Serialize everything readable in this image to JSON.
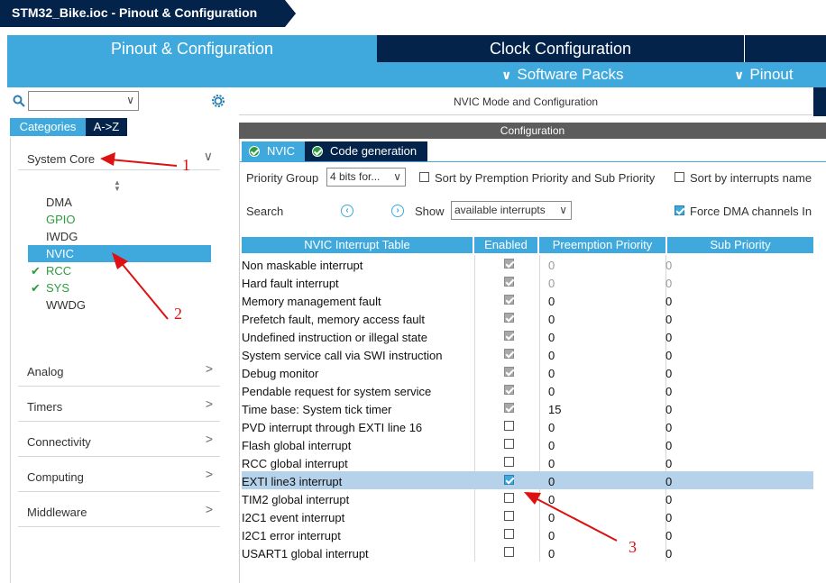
{
  "window": {
    "title": "STM32_Bike.ioc - Pinout & Configuration"
  },
  "tabs": {
    "pinout": "Pinout & Configuration",
    "clock": "Clock Configuration",
    "software_packs": "Software Packs",
    "pinout_menu": "Pinout"
  },
  "sidebar": {
    "search_value": "",
    "tab_categories": "Categories",
    "tab_az": "A->Z",
    "categories": [
      "System Core",
      "Analog",
      "Timers",
      "Connectivity",
      "Computing",
      "Middleware"
    ],
    "system_core_items": [
      {
        "label": "DMA",
        "state": "normal"
      },
      {
        "label": "GPIO",
        "state": "green"
      },
      {
        "label": "IWDG",
        "state": "normal"
      },
      {
        "label": "NVIC",
        "state": "selected"
      },
      {
        "label": "RCC",
        "state": "checked"
      },
      {
        "label": "SYS",
        "state": "checked"
      },
      {
        "label": "WWDG",
        "state": "normal"
      }
    ]
  },
  "main": {
    "mode_title": "NVIC Mode and Configuration",
    "config_title": "Configuration",
    "subtab_nvic": "NVIC",
    "subtab_codegen": "Code generation",
    "priority_group_label": "Priority Group",
    "priority_group_value": "4 bits for...",
    "sort_preemption_label": "Sort by Premption Priority and Sub Priority",
    "sort_preemption_checked": false,
    "sort_name_label": "Sort by interrupts name",
    "sort_name_checked": false,
    "search_label": "Search",
    "show_label": "Show",
    "show_value": "available interrupts",
    "force_dma_label": "Force DMA channels In",
    "force_dma_checked": true
  },
  "table": {
    "headers": [
      "NVIC Interrupt Table",
      "Enabled",
      "Preemption Priority",
      "Sub Priority"
    ],
    "rows": [
      {
        "name": "Non maskable interrupt",
        "enabled": true,
        "locked": true,
        "pre": "0",
        "sub": "0",
        "dim": true
      },
      {
        "name": "Hard fault interrupt",
        "enabled": true,
        "locked": true,
        "pre": "0",
        "sub": "0",
        "dim": true
      },
      {
        "name": "Memory management fault",
        "enabled": true,
        "locked": true,
        "pre": "0",
        "sub": "0"
      },
      {
        "name": "Prefetch fault, memory access fault",
        "enabled": true,
        "locked": true,
        "pre": "0",
        "sub": "0"
      },
      {
        "name": "Undefined instruction or illegal state",
        "enabled": true,
        "locked": true,
        "pre": "0",
        "sub": "0"
      },
      {
        "name": "System service call via SWI instruction",
        "enabled": true,
        "locked": true,
        "pre": "0",
        "sub": "0"
      },
      {
        "name": "Debug monitor",
        "enabled": true,
        "locked": true,
        "pre": "0",
        "sub": "0"
      },
      {
        "name": "Pendable request for system service",
        "enabled": true,
        "locked": true,
        "pre": "0",
        "sub": "0"
      },
      {
        "name": "Time base: System tick timer",
        "enabled": true,
        "locked": true,
        "pre": "15",
        "sub": "0"
      },
      {
        "name": "PVD interrupt through EXTI line 16",
        "enabled": false,
        "pre": "0",
        "sub": "0"
      },
      {
        "name": "Flash global interrupt",
        "enabled": false,
        "pre": "0",
        "sub": "0"
      },
      {
        "name": "RCC global interrupt",
        "enabled": false,
        "pre": "0",
        "sub": "0"
      },
      {
        "name": "EXTI line3 interrupt",
        "enabled": true,
        "selected": true,
        "pre": "0",
        "sub": "0"
      },
      {
        "name": "TIM2 global interrupt",
        "enabled": false,
        "pre": "0",
        "sub": "0"
      },
      {
        "name": "I2C1 event interrupt",
        "enabled": false,
        "pre": "0",
        "sub": "0"
      },
      {
        "name": "I2C1 error interrupt",
        "enabled": false,
        "pre": "0",
        "sub": "0"
      },
      {
        "name": "USART1 global interrupt",
        "enabled": false,
        "pre": "0",
        "sub": "0"
      }
    ]
  },
  "annotations": {
    "labels": [
      "1",
      "2",
      "3"
    ],
    "color": "#dd1111"
  },
  "colors": {
    "accent": "#3fa9dd",
    "navy": "#03234b",
    "green": "#2e9b3e",
    "selected_row": "#b6d1ea"
  }
}
